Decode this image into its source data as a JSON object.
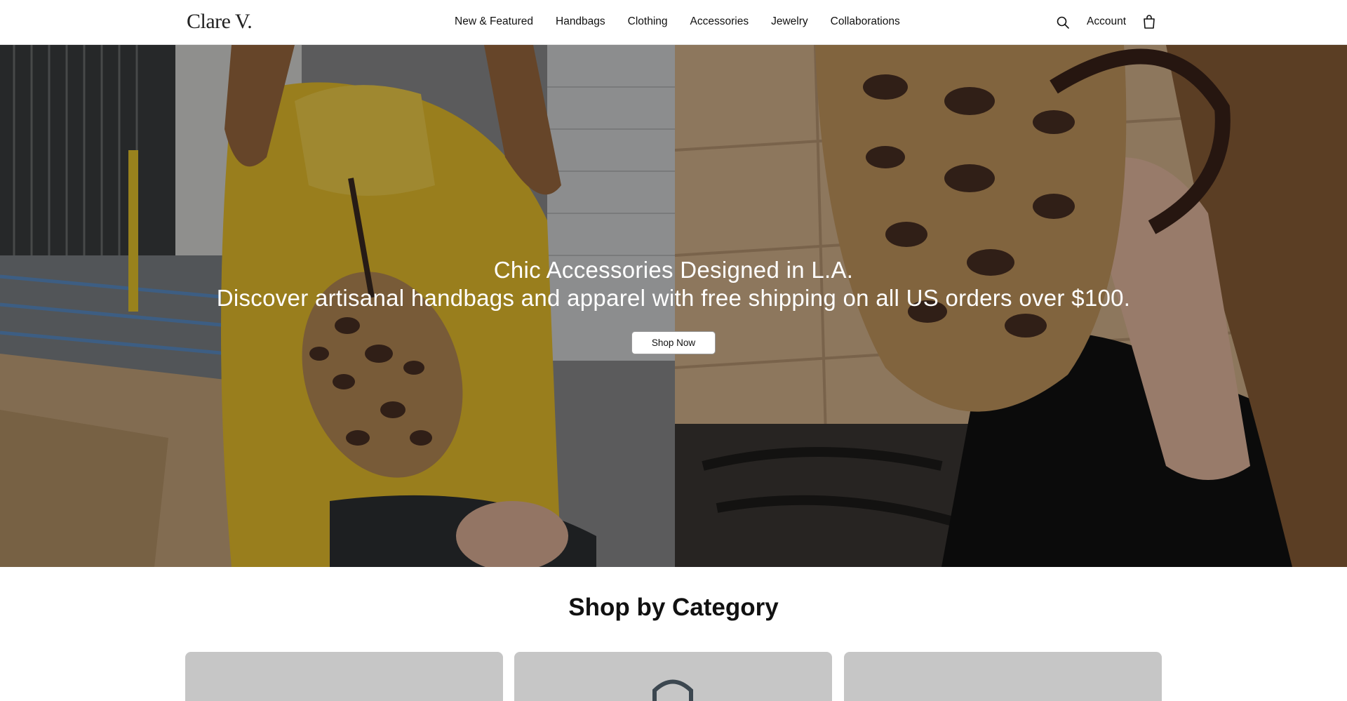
{
  "header": {
    "logo": "Clare V.",
    "nav": [
      "New & Featured",
      "Handbags",
      "Clothing",
      "Accessories",
      "Jewelry",
      "Collaborations"
    ],
    "account_label": "Account",
    "icons": [
      "search-icon",
      "shopping-bag-icon"
    ]
  },
  "hero": {
    "title": "Chic Accessories Designed in L.A.",
    "subtitle": "Discover artisanal handbags and apparel with free shipping on all US orders over $100.",
    "button_label": "Shop Now"
  },
  "categories": {
    "title": "Shop by Category"
  },
  "colors": {
    "accent_yellow": "#e9bf2c",
    "leopard_tan": "#b78b55",
    "leopard_spot": "#4a2f23"
  }
}
